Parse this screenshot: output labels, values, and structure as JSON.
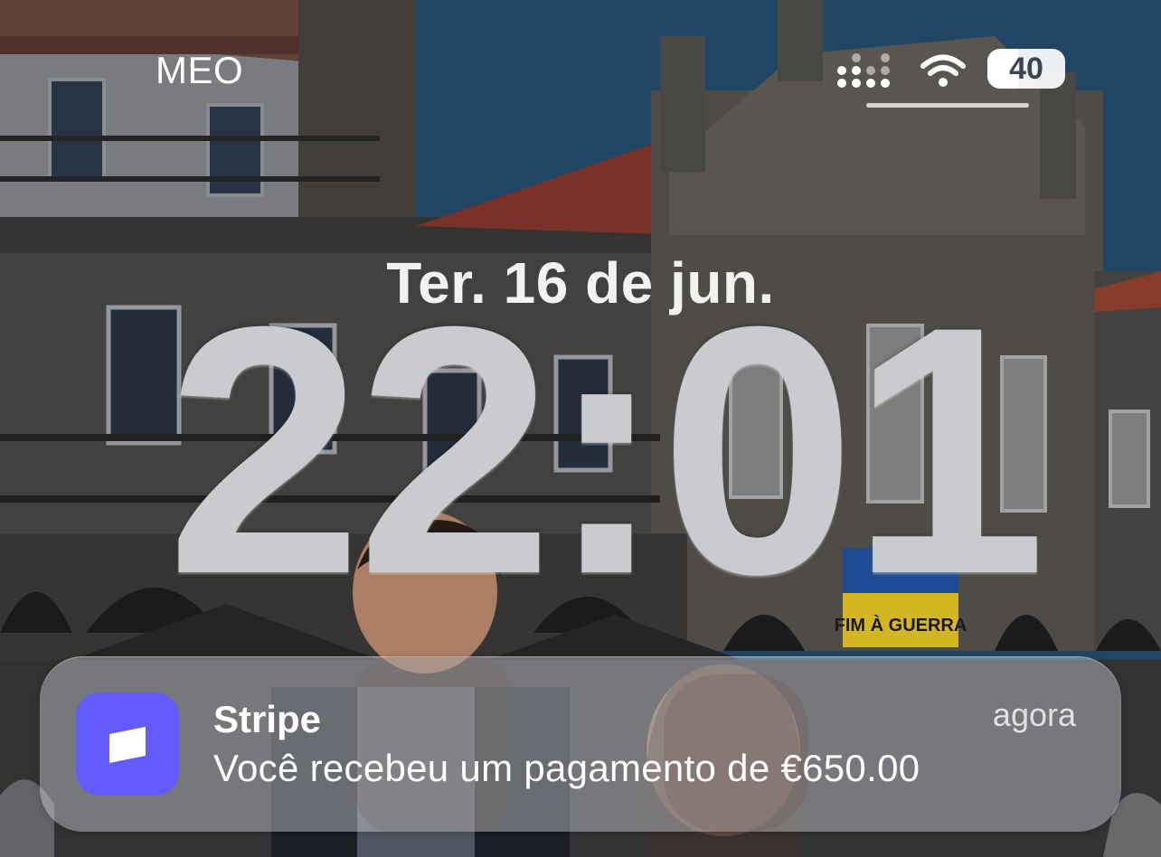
{
  "status_bar": {
    "carrier": "MEO",
    "battery_percent": "40",
    "battery_level": 0.4,
    "signal_icon": "cellular-signal-icon",
    "wifi_icon": "wifi-icon"
  },
  "lock_screen": {
    "date": "Ter. 16 de jun.",
    "time": "22:01"
  },
  "wallpaper": {
    "banner_text": "FIM À GUERRA",
    "colors": {
      "sky": "#2f6b9a",
      "roof": "#b5503a",
      "stone": "#5e5b57",
      "flag_blue": "#2356a8",
      "flag_yellow": "#f2cf2a"
    }
  },
  "notification": {
    "app_name": "Stripe",
    "time_label": "agora",
    "message": "Você recebeu um pagamento de €650.00",
    "icon": "stripe-app-icon",
    "icon_color": "#635bff"
  }
}
